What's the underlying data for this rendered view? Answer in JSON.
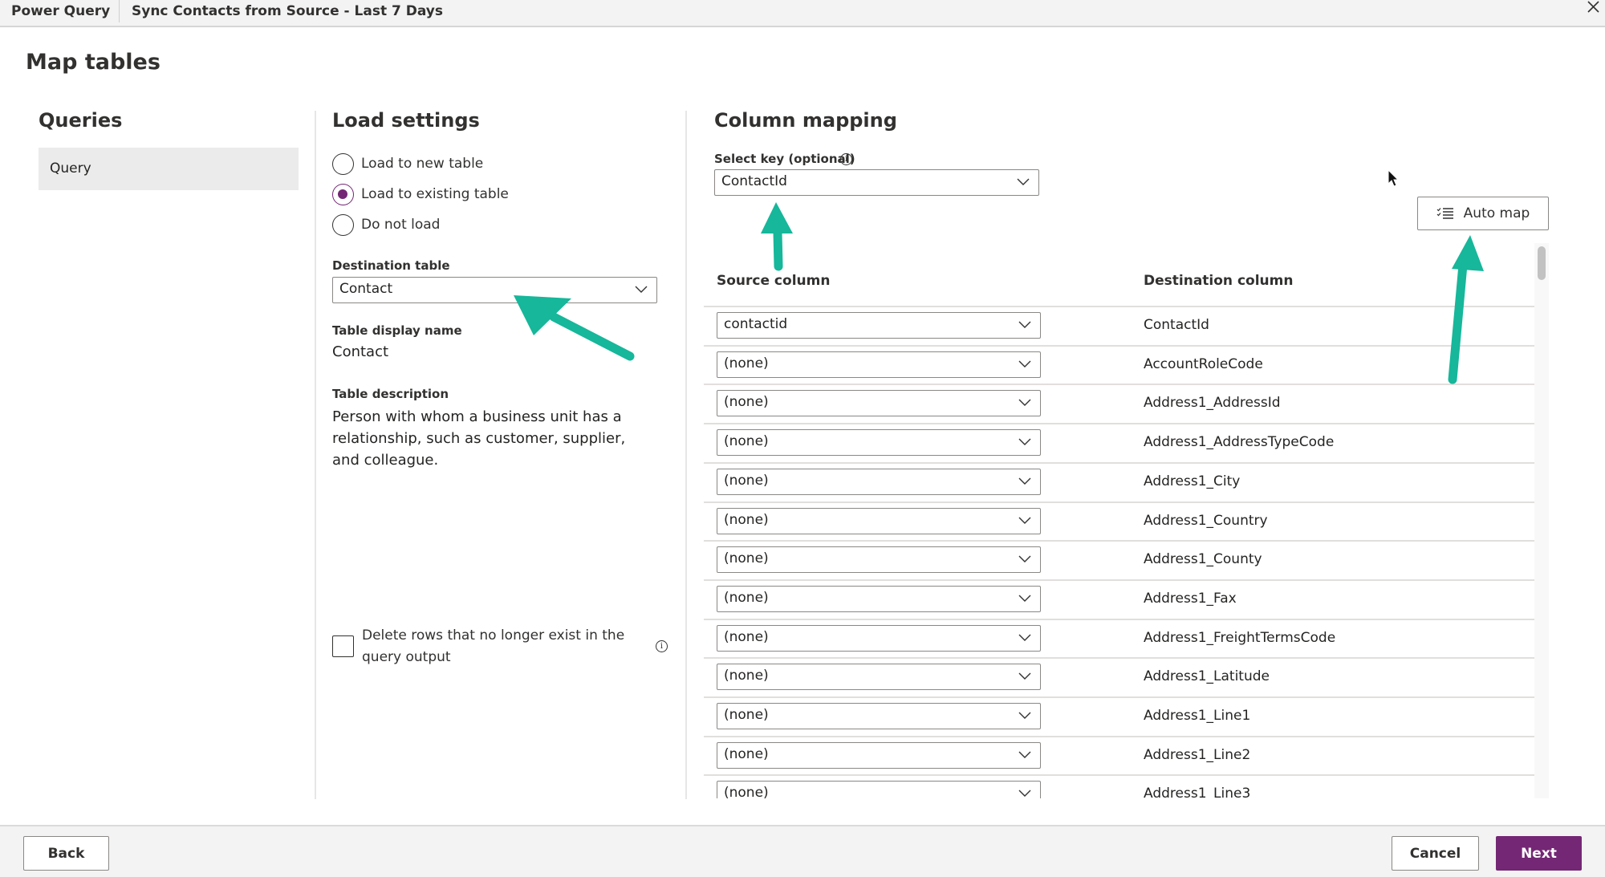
{
  "titlebar": {
    "app_name": "Power Query",
    "document_title": "Sync Contacts from Source - Last 7 Days"
  },
  "page": {
    "title": "Map tables"
  },
  "queries": {
    "heading": "Queries",
    "items": [
      {
        "label": "Query",
        "selected": true
      }
    ]
  },
  "load_settings": {
    "heading": "Load settings",
    "options": [
      {
        "label": "Load to new table",
        "checked": false
      },
      {
        "label": "Load to existing table",
        "checked": true
      },
      {
        "label": "Do not load",
        "checked": false
      }
    ],
    "destination_table_label": "Destination table",
    "destination_table_value": "Contact",
    "display_name_label": "Table display name",
    "display_name_value": "Contact",
    "description_label": "Table description",
    "description_value": "Person with whom a business unit has a relationship, such as customer, supplier, and colleague.",
    "delete_rows_label": "Delete rows that no longer exist in the query output",
    "delete_rows_checked": false
  },
  "column_mapping": {
    "heading": "Column mapping",
    "select_key_label": "Select key (optional)",
    "select_key_value": "ContactId",
    "auto_map_label": "Auto map",
    "source_header": "Source column",
    "destination_header": "Destination column",
    "rows": [
      {
        "source": "contactid",
        "destination": "ContactId"
      },
      {
        "source": "(none)",
        "destination": "AccountRoleCode"
      },
      {
        "source": "(none)",
        "destination": "Address1_AddressId"
      },
      {
        "source": "(none)",
        "destination": "Address1_AddressTypeCode"
      },
      {
        "source": "(none)",
        "destination": "Address1_City"
      },
      {
        "source": "(none)",
        "destination": "Address1_Country"
      },
      {
        "source": "(none)",
        "destination": "Address1_County"
      },
      {
        "source": "(none)",
        "destination": "Address1_Fax"
      },
      {
        "source": "(none)",
        "destination": "Address1_FreightTermsCode"
      },
      {
        "source": "(none)",
        "destination": "Address1_Latitude"
      },
      {
        "source": "(none)",
        "destination": "Address1_Line1"
      },
      {
        "source": "(none)",
        "destination": "Address1_Line2"
      },
      {
        "source": "(none)",
        "destination": "Address1_Line3"
      }
    ]
  },
  "footer": {
    "back_label": "Back",
    "cancel_label": "Cancel",
    "next_label": "Next"
  },
  "colors": {
    "accent": "#742774",
    "annotation_arrow": "#16b79a"
  }
}
